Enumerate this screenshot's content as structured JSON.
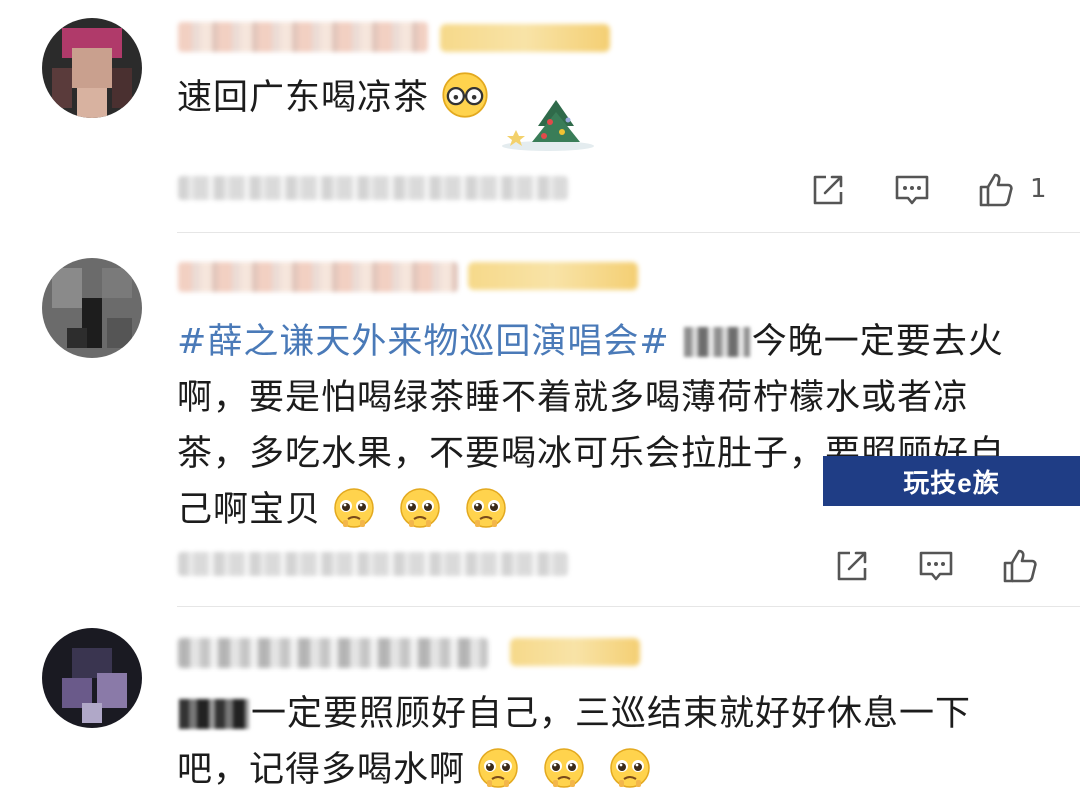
{
  "comments": [
    {
      "text": "速回广东喝凉茶",
      "like_count": "1",
      "actions": [
        "share-icon",
        "reply-icon",
        "like-icon"
      ]
    },
    {
      "topic": "#薛之谦天外来物巡回演唱会#",
      "text": "今晚一定要去火啊，要是怕喝绿茶睡不着就多喝薄荷柠檬水或者凉茶，多吃水果，不要喝冰可乐会拉肚子，要照顾好自己啊宝贝",
      "like_count": "",
      "actions": [
        "share-icon",
        "reply-icon",
        "like-icon"
      ]
    },
    {
      "text": "一定要照顾好自己，三巡结束就好好休息一下吧，记得多喝水啊",
      "actions": []
    }
  ],
  "watermark": {
    "label": "玩技e族"
  },
  "colors": {
    "topic": "#4a7ab8",
    "watermark_bg": "#1f3d85",
    "divider": "#e6e6e6"
  }
}
